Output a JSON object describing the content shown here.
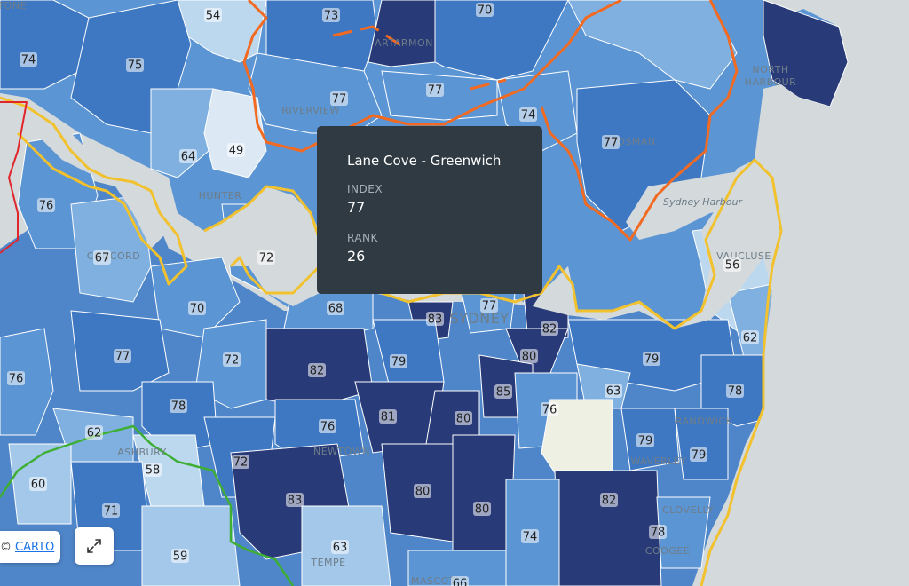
{
  "tooltip": {
    "title": "Lane Cove - Greenwich",
    "index_label": "INDEX",
    "index_value": "77",
    "rank_label": "RANK",
    "rank_value": "26"
  },
  "attribution": {
    "prefix": "©",
    "link_text": "CARTO"
  },
  "fullscreen_icon": "expand-arrows-icon",
  "colors": {
    "shade_54": "#bcd8ef",
    "shade_60": "#a3c8ea",
    "shade_65": "#7fb0e0",
    "shade_70": "#5b95d3",
    "shade_75": "#3f78c2",
    "shade_80": "#2c4f96",
    "shade_85": "#283a78",
    "water": "#d4dadc",
    "boundary_orange": "#f26a21",
    "boundary_yellow": "#f2c12e",
    "boundary_green": "#3fae35",
    "boundary_red": "#e0252b"
  },
  "place_labels": [
    "STONE",
    "ARTARMON",
    "RIVERVIEW",
    "NORTH",
    "HARBOUR",
    "HUNTER",
    "CONCORD",
    "SYDNEY",
    "VAUCLUSE",
    "ASHBURY",
    "NEWTOWN",
    "TEMPE",
    "MASCOT",
    "WAVERLEY",
    "CLOVELLY",
    "COOGEE",
    "RANDWICK",
    "MOSMAN"
  ],
  "water_labels": [
    "Sydney Harbour"
  ],
  "region_values": [
    "54",
    "73",
    "70",
    "74",
    "75",
    "77",
    "77",
    "74",
    "77",
    "64",
    "49",
    "76",
    "67",
    "72",
    "70",
    "68",
    "77",
    "83",
    "82",
    "56",
    "62",
    "76",
    "77",
    "72",
    "82",
    "79",
    "80",
    "85",
    "79",
    "63",
    "78",
    "78",
    "81",
    "80",
    "76",
    "76",
    "79",
    "79",
    "62",
    "58",
    "72",
    "60",
    "71",
    "83",
    "80",
    "80",
    "82",
    "74",
    "78",
    "63",
    "59",
    "66"
  ]
}
